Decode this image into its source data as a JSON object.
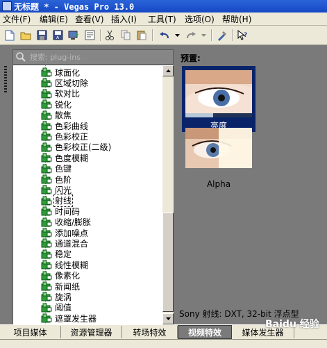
{
  "window": {
    "title": "无标题 * - Vegas Pro 13.0"
  },
  "menu": [
    {
      "label": "文件(F)"
    },
    {
      "label": "编辑(E)"
    },
    {
      "label": "查看(V)"
    },
    {
      "label": "插入(I)"
    },
    {
      "label": "工具(T)"
    },
    {
      "label": "选项(O)"
    },
    {
      "label": "帮助(H)"
    }
  ],
  "toolbar": {
    "icons": [
      "new-icon",
      "open-icon",
      "save-icon",
      "save-as-icon",
      "render-icon",
      "properties-icon",
      "cut-icon",
      "copy-icon",
      "paste-icon",
      "undo-icon",
      "redo-icon",
      "enable-snapping-icon",
      "whats-this-icon"
    ]
  },
  "search": {
    "placeholder": "搜索: plug-ins"
  },
  "tree": {
    "items": [
      {
        "label": "球面化"
      },
      {
        "label": "区域切除"
      },
      {
        "label": "软对比"
      },
      {
        "label": "锐化"
      },
      {
        "label": "散焦"
      },
      {
        "label": "色彩曲线"
      },
      {
        "label": "色彩校正"
      },
      {
        "label": "色彩校正(二级)"
      },
      {
        "label": "色度模糊"
      },
      {
        "label": "色键"
      },
      {
        "label": "色阶"
      },
      {
        "label": "闪光"
      },
      {
        "label": "射线",
        "selected": true
      },
      {
        "label": "时间码"
      },
      {
        "label": "收缩/膨胀"
      },
      {
        "label": "添加噪点"
      },
      {
        "label": "通道混合"
      },
      {
        "label": "稳定"
      },
      {
        "label": "线性模糊"
      },
      {
        "label": "像素化"
      },
      {
        "label": "新闻纸"
      },
      {
        "label": "旋涡"
      },
      {
        "label": "阈值"
      },
      {
        "label": "遮罩发生器"
      }
    ]
  },
  "preview": {
    "label": "预置:",
    "presets": [
      {
        "name": "亮度",
        "selected": true
      },
      {
        "name": "Alpha",
        "selected": false
      }
    ],
    "status": "Sony 射线: DXT, 32-bit 浮点型"
  },
  "tabs": [
    {
      "label": "项目媒体",
      "active": false
    },
    {
      "label": "资源管理器",
      "active": false
    },
    {
      "label": "转场特效",
      "active": false
    },
    {
      "label": "视频特效",
      "active": true
    },
    {
      "label": "媒体发生器",
      "active": false
    }
  ],
  "watermark": "Baidu 经验",
  "colors": {
    "titlebar": "#1a52cc",
    "selection": "#0a246a",
    "panel": "#7a7a7a",
    "icon_green": "#2d9b3a"
  }
}
